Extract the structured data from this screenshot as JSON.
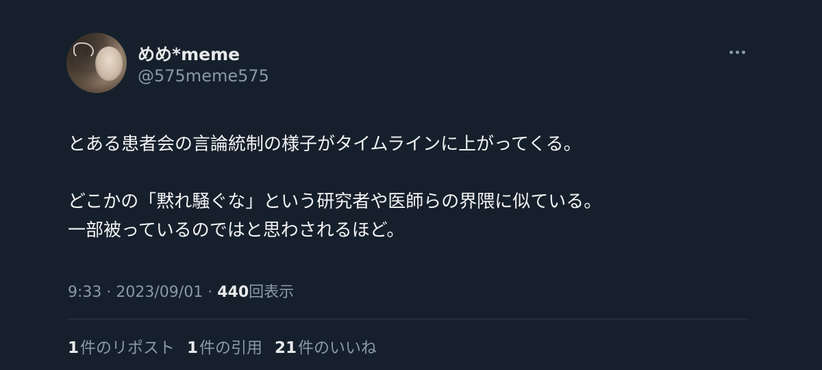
{
  "author": {
    "display_name": "めめ*meme",
    "handle": "@575meme575"
  },
  "tweet": {
    "lines": [
      "とある患者会の言論統制の様子がタイムラインに上がってくる。",
      "どこかの「黙れ騒ぐな」という研究者や医師らの界隈に似ている。",
      "一部被っているのではと思わされるほど。"
    ]
  },
  "meta": {
    "time": "9:33",
    "separator": "·",
    "date": "2023/09/01",
    "views_count": "440",
    "views_label": "回表示"
  },
  "stats": {
    "reposts_count": "1",
    "reposts_label": "件のリポスト",
    "quotes_count": "1",
    "quotes_label": "件の引用",
    "likes_count": "21",
    "likes_label": "件のいいね"
  },
  "icons": {
    "more": "more-horizontal-icon"
  },
  "colors": {
    "background": "#16202c",
    "primary_text": "#e7e9ea",
    "secondary_text": "#8b98a5",
    "divider": "#2f3b47"
  }
}
